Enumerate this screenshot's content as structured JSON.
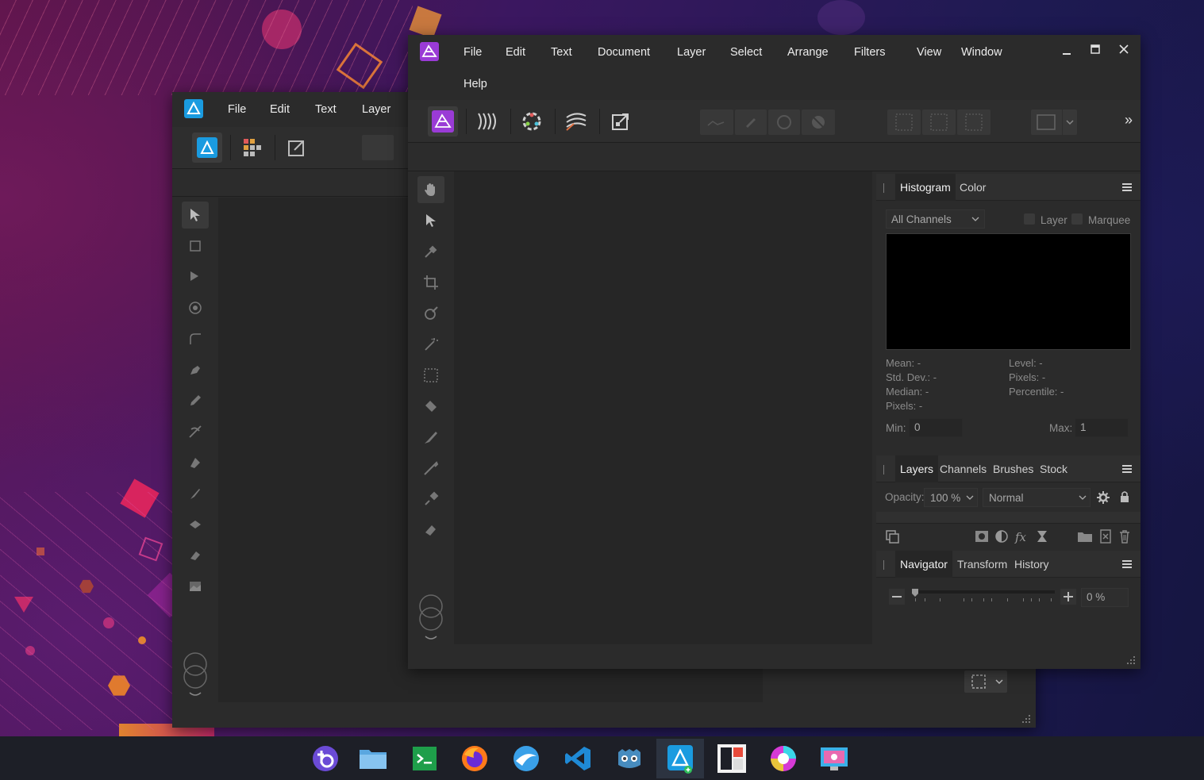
{
  "back_window": {
    "menu": [
      "File",
      "Edit",
      "Text",
      "Layer"
    ]
  },
  "front_window": {
    "menu": [
      "File",
      "Edit",
      "Text",
      "Document",
      "Layer",
      "Select",
      "Arrange",
      "Filters",
      "View",
      "Window",
      "Help"
    ],
    "overflow_glyph": "»",
    "panels": {
      "histogram": {
        "tabs": [
          "Histogram",
          "Color"
        ],
        "channel_select": "All Channels",
        "opt_layer": "Layer",
        "opt_marquee": "Marquee",
        "stats_left": [
          "Mean: -",
          "Std. Dev.: -",
          "Median: -",
          "Pixels: -"
        ],
        "stats_right": [
          "Level: -",
          "Pixels: -",
          "Percentile: -"
        ],
        "min_label": "Min:",
        "min_value": "0",
        "max_label": "Max:",
        "max_value": "1"
      },
      "layers": {
        "tabs": [
          "Layers",
          "Channels",
          "Brushes",
          "Stock"
        ],
        "opacity_label": "Opacity:",
        "opacity_value": "100 %",
        "blend_mode": "Normal"
      },
      "navigator": {
        "tabs": [
          "Navigator",
          "Transform",
          "History"
        ],
        "zoom_value": "0 %"
      }
    }
  },
  "taskbar": {
    "apps": [
      "tabby-icon",
      "file-explorer-icon",
      "terminal-icon",
      "firefox-icon",
      "browser-icon",
      "vscode-icon",
      "godot-icon",
      "affinity-designer-icon",
      "tiles-icon",
      "color-app-icon",
      "screen-capture-icon"
    ],
    "active": "affinity-designer-icon"
  },
  "colors": {
    "accent_photo": "#9a3bd6",
    "accent_designer": "#1a9be0",
    "window_bg": "#2b2b2b",
    "canvas_bg": "#262626"
  }
}
